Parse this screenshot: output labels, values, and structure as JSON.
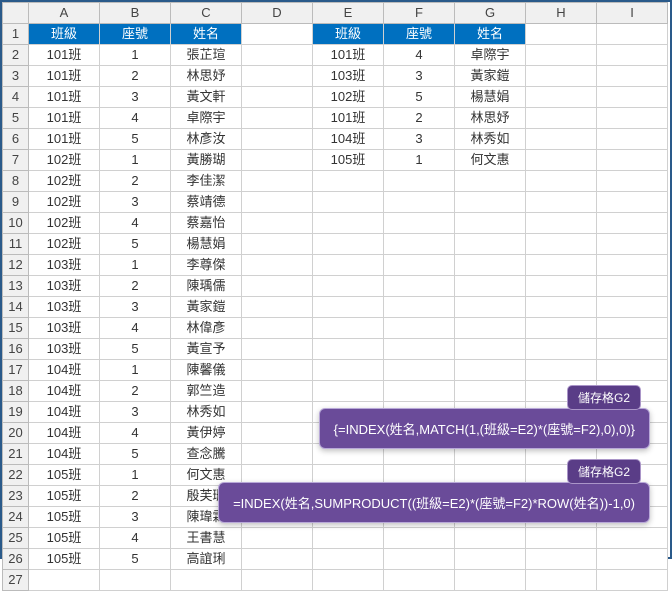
{
  "columns": [
    "A",
    "B",
    "C",
    "D",
    "E",
    "F",
    "G",
    "H",
    "I"
  ],
  "rowcount": 27,
  "main_headers": {
    "class": "班級",
    "seat": "座號",
    "name": "姓名"
  },
  "main_rows": [
    {
      "c": "101班",
      "s": "1",
      "n": "張芷瑄"
    },
    {
      "c": "101班",
      "s": "2",
      "n": "林思妤"
    },
    {
      "c": "101班",
      "s": "3",
      "n": "黃文軒"
    },
    {
      "c": "101班",
      "s": "4",
      "n": "卓際宇"
    },
    {
      "c": "101班",
      "s": "5",
      "n": "林彥汝"
    },
    {
      "c": "102班",
      "s": "1",
      "n": "黃勝瑚"
    },
    {
      "c": "102班",
      "s": "2",
      "n": "李佳潔"
    },
    {
      "c": "102班",
      "s": "3",
      "n": "蔡靖德"
    },
    {
      "c": "102班",
      "s": "4",
      "n": "蔡嘉怡"
    },
    {
      "c": "102班",
      "s": "5",
      "n": "楊慧娟"
    },
    {
      "c": "103班",
      "s": "1",
      "n": "李尊傑"
    },
    {
      "c": "103班",
      "s": "2",
      "n": "陳瑀儒"
    },
    {
      "c": "103班",
      "s": "3",
      "n": "黃家鎧"
    },
    {
      "c": "103班",
      "s": "4",
      "n": "林偉彥"
    },
    {
      "c": "103班",
      "s": "5",
      "n": "黃宣予"
    },
    {
      "c": "104班",
      "s": "1",
      "n": "陳馨儀"
    },
    {
      "c": "104班",
      "s": "2",
      "n": "郭竺造"
    },
    {
      "c": "104班",
      "s": "3",
      "n": "林秀如"
    },
    {
      "c": "104班",
      "s": "4",
      "n": "黃伊婷"
    },
    {
      "c": "104班",
      "s": "5",
      "n": "查念騰"
    },
    {
      "c": "105班",
      "s": "1",
      "n": "何文惠"
    },
    {
      "c": "105班",
      "s": "2",
      "n": "殷芙珊"
    },
    {
      "c": "105班",
      "s": "3",
      "n": "陳瑋霖"
    },
    {
      "c": "105班",
      "s": "4",
      "n": "王書慧"
    },
    {
      "c": "105班",
      "s": "5",
      "n": "高誼琍"
    }
  ],
  "lookup_headers": {
    "class": "班級",
    "seat": "座號",
    "name": "姓名"
  },
  "lookup_rows": [
    {
      "c": "101班",
      "s": "4",
      "n": "卓際宇"
    },
    {
      "c": "103班",
      "s": "3",
      "n": "黃家鎧"
    },
    {
      "c": "102班",
      "s": "5",
      "n": "楊慧娟"
    },
    {
      "c": "101班",
      "s": "2",
      "n": "林思妤"
    },
    {
      "c": "104班",
      "s": "3",
      "n": "林秀如"
    },
    {
      "c": "105班",
      "s": "1",
      "n": "何文惠"
    }
  ],
  "callouts": [
    {
      "badge": "儲存格G2",
      "formula": "{=INDEX(姓名,MATCH(1,(班級=E2)*(座號=F2),0),0)}"
    },
    {
      "badge": "儲存格G2",
      "formula": "=INDEX(姓名,SUMPRODUCT((班級=E2)*(座號=F2)*ROW(姓名))-1,0)"
    }
  ]
}
